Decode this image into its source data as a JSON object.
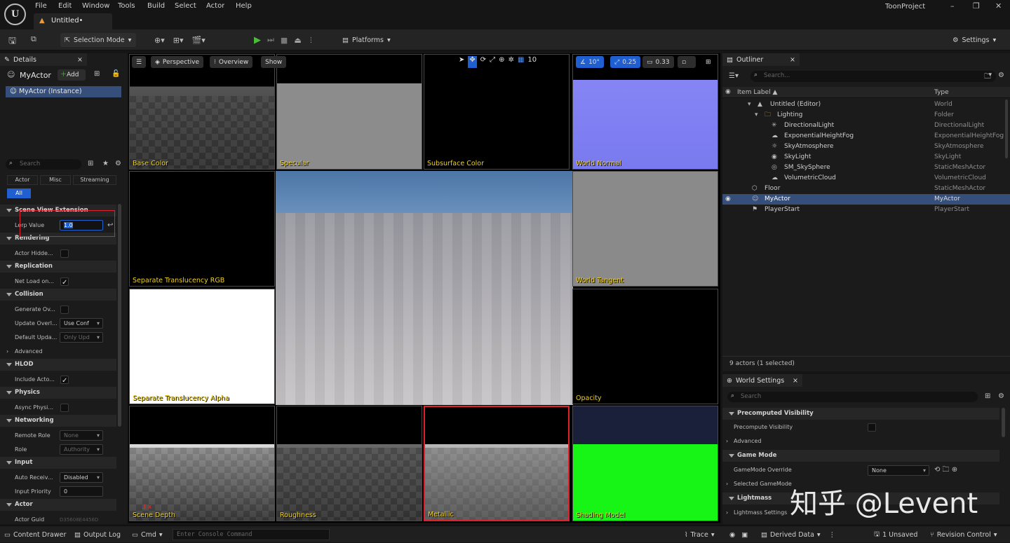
{
  "window": {
    "title": "ToonProject",
    "doc_tab": "Untitled•",
    "logo": "U",
    "controls": [
      "–",
      "❐",
      "✕"
    ]
  },
  "menu": [
    "File",
    "Edit",
    "Window",
    "Tools",
    "Build",
    "Select",
    "Actor",
    "Help"
  ],
  "toolbar": {
    "mode": "Selection Mode",
    "platforms": "Platforms",
    "settings": "Settings"
  },
  "details": {
    "tab": "Details",
    "actor": "MyActor",
    "add": "Add",
    "instance": "MyActor (Instance)",
    "search_placeholder": "Search",
    "filters": [
      "Actor",
      "Misc",
      "Streaming"
    ],
    "all": "All",
    "sections": [
      {
        "title": "Scene View Extension",
        "rows": [
          {
            "label": "Lerp Value",
            "value": "1.0",
            "kind": "num"
          }
        ]
      },
      {
        "title": "Rendering",
        "rows": [
          {
            "label": "Actor Hidde...",
            "kind": "chk",
            "checked": false
          }
        ]
      },
      {
        "title": "Replication",
        "rows": [
          {
            "label": "Net Load on...",
            "kind": "chk",
            "checked": true
          }
        ]
      },
      {
        "title": "Collision",
        "rows": [
          {
            "label": "Generate Ov...",
            "kind": "chk",
            "checked": false
          },
          {
            "label": "Update Overl...",
            "kind": "combo",
            "value": "Use Conf"
          },
          {
            "label": "Default Upda...",
            "kind": "combo",
            "value": "Only Upd",
            "disabled": true
          },
          {
            "label": "Advanced",
            "kind": "sub"
          }
        ]
      },
      {
        "title": "HLOD",
        "rows": [
          {
            "label": "Include Acto...",
            "kind": "chk",
            "checked": true
          }
        ]
      },
      {
        "title": "Physics",
        "rows": [
          {
            "label": "Async Physi...",
            "kind": "chk",
            "checked": false
          }
        ]
      },
      {
        "title": "Networking",
        "rows": [
          {
            "label": "Remote Role",
            "kind": "combo",
            "value": "None",
            "disabled": true
          },
          {
            "label": "Role",
            "kind": "combo",
            "value": "Authority",
            "disabled": true
          }
        ]
      },
      {
        "title": "Input",
        "rows": [
          {
            "label": "Auto Receiv...",
            "kind": "combo",
            "value": "Disabled"
          },
          {
            "label": "Input Priority",
            "kind": "num",
            "value": "0"
          }
        ]
      },
      {
        "title": "Actor",
        "rows": [
          {
            "label": "Actor Guid",
            "kind": "text",
            "value": "D35608E4456D"
          }
        ]
      }
    ]
  },
  "viewport": {
    "perspective": "Perspective",
    "overview": "Overview",
    "show": "Show",
    "grid": "10",
    "angle": "10°",
    "scale": "0.25",
    "camera": "0.33",
    "tiles": [
      "Base Color",
      "Specular",
      "Subsurface Color",
      "World Normal",
      "Separate Translucency RGB",
      "World Tangent",
      "Separate Translucency Alpha",
      "Opacity",
      "Scene Depth",
      "Roughness",
      "Metallic",
      "Shading Model"
    ]
  },
  "outliner": {
    "tab": "Outliner",
    "search_placeholder": "Search...",
    "col_label": "Item Label ▲",
    "col_type": "Type",
    "status": "9 actors (1 selected)",
    "rows": [
      {
        "name": "Untitled (Editor)",
        "type": "World"
      },
      {
        "name": "Lighting",
        "type": "Folder"
      },
      {
        "name": "DirectionalLight",
        "type": "DirectionalLight"
      },
      {
        "name": "ExponentialHeightFog",
        "type": "ExponentialHeightFog"
      },
      {
        "name": "SkyAtmosphere",
        "type": "SkyAtmosphere"
      },
      {
        "name": "SkyLight",
        "type": "SkyLight"
      },
      {
        "name": "SM_SkySphere",
        "type": "StaticMeshActor"
      },
      {
        "name": "VolumetricCloud",
        "type": "VolumetricCloud"
      },
      {
        "name": "Floor",
        "type": "StaticMeshActor"
      },
      {
        "name": "MyActor",
        "type": "MyActor"
      },
      {
        "name": "PlayerStart",
        "type": "PlayerStart"
      }
    ]
  },
  "world_settings": {
    "tab": "World Settings",
    "search_placeholder": "Search",
    "precomputed": "Precomputed Visibility",
    "precompute_row": "Precompute Visibility",
    "advanced": "Advanced",
    "game_mode": "Game Mode",
    "gm_override": "GameMode Override",
    "gm_value": "None",
    "selected_gm": "Selected GameMode",
    "lightmass": "Lightmass",
    "lightmass_settings": "Lightmass Settings"
  },
  "bottom": {
    "content_drawer": "Content Drawer",
    "output_log": "Output Log",
    "cmd": "Cmd",
    "console_placeholder": "Enter Console Command",
    "trace": "Trace",
    "derived": "Derived Data",
    "unsaved": "1 Unsaved",
    "revision": "Revision Control"
  },
  "watermark": "知乎 @Levent"
}
